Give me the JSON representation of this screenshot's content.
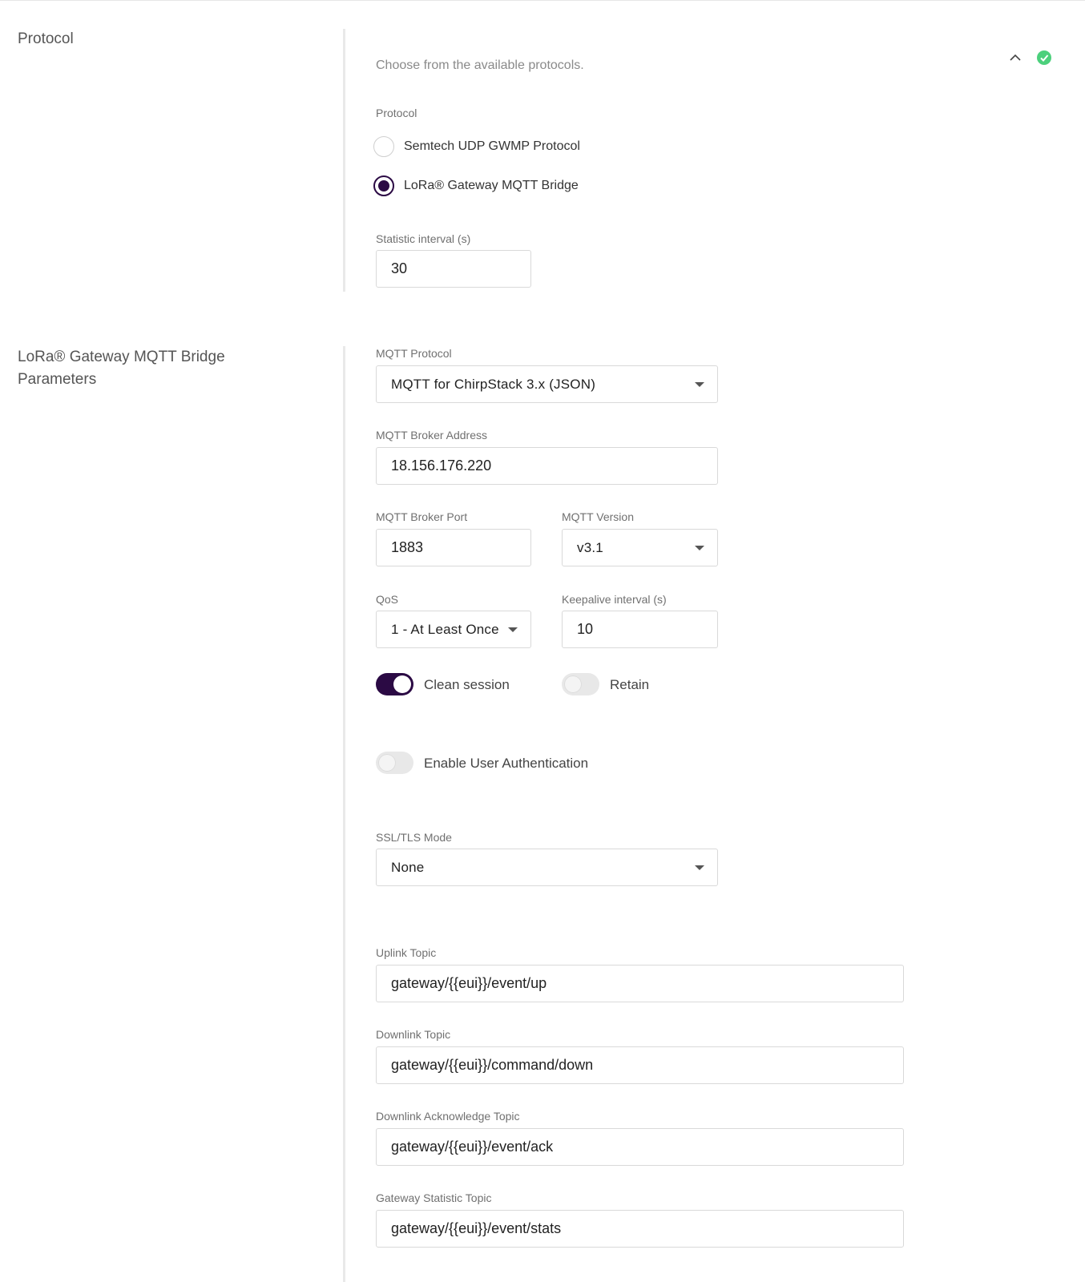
{
  "protocol_section": {
    "title": "Protocol",
    "description": "Choose from the available protocols.",
    "protocol_label": "Protocol",
    "options": [
      {
        "label": "Semtech UDP GWMP Protocol",
        "selected": false
      },
      {
        "label": "LoRa® Gateway MQTT Bridge",
        "selected": true
      }
    ],
    "statistic_interval_label": "Statistic interval (s)",
    "statistic_interval_value": "30",
    "collapse_icon": "chevron-up-icon",
    "status_icon": "check-circle-icon",
    "status_color": "#4cd07c"
  },
  "mqtt_section": {
    "title_line1": "LoRa® Gateway MQTT Bridge",
    "title_line2": "Parameters",
    "mqtt_protocol_label": "MQTT Protocol",
    "mqtt_protocol_value": "MQTT for ChirpStack 3.x (JSON)",
    "broker_address_label": "MQTT Broker Address",
    "broker_address_value": "18.156.176.220",
    "broker_port_label": "MQTT Broker Port",
    "broker_port_value": "1883",
    "mqtt_version_label": "MQTT Version",
    "mqtt_version_value": "v3.1",
    "qos_label": "QoS",
    "qos_value": "1 - At Least Once",
    "keepalive_label": "Keepalive interval (s)",
    "keepalive_value": "10",
    "clean_session_label": "Clean session",
    "clean_session_on": true,
    "retain_label": "Retain",
    "retain_on": false,
    "user_auth_label": "Enable User Authentication",
    "user_auth_on": false,
    "ssl_label": "SSL/TLS Mode",
    "ssl_value": "None",
    "uplink_label": "Uplink Topic",
    "uplink_value": "gateway/{{eui}}/event/up",
    "downlink_label": "Downlink Topic",
    "downlink_value": "gateway/{{eui}}/command/down",
    "downlink_ack_label": "Downlink Acknowledge Topic",
    "downlink_ack_value": "gateway/{{eui}}/event/ack",
    "stats_label": "Gateway Statistic Topic",
    "stats_value": "gateway/{{eui}}/event/stats"
  },
  "accent_color": "#2b0a44"
}
